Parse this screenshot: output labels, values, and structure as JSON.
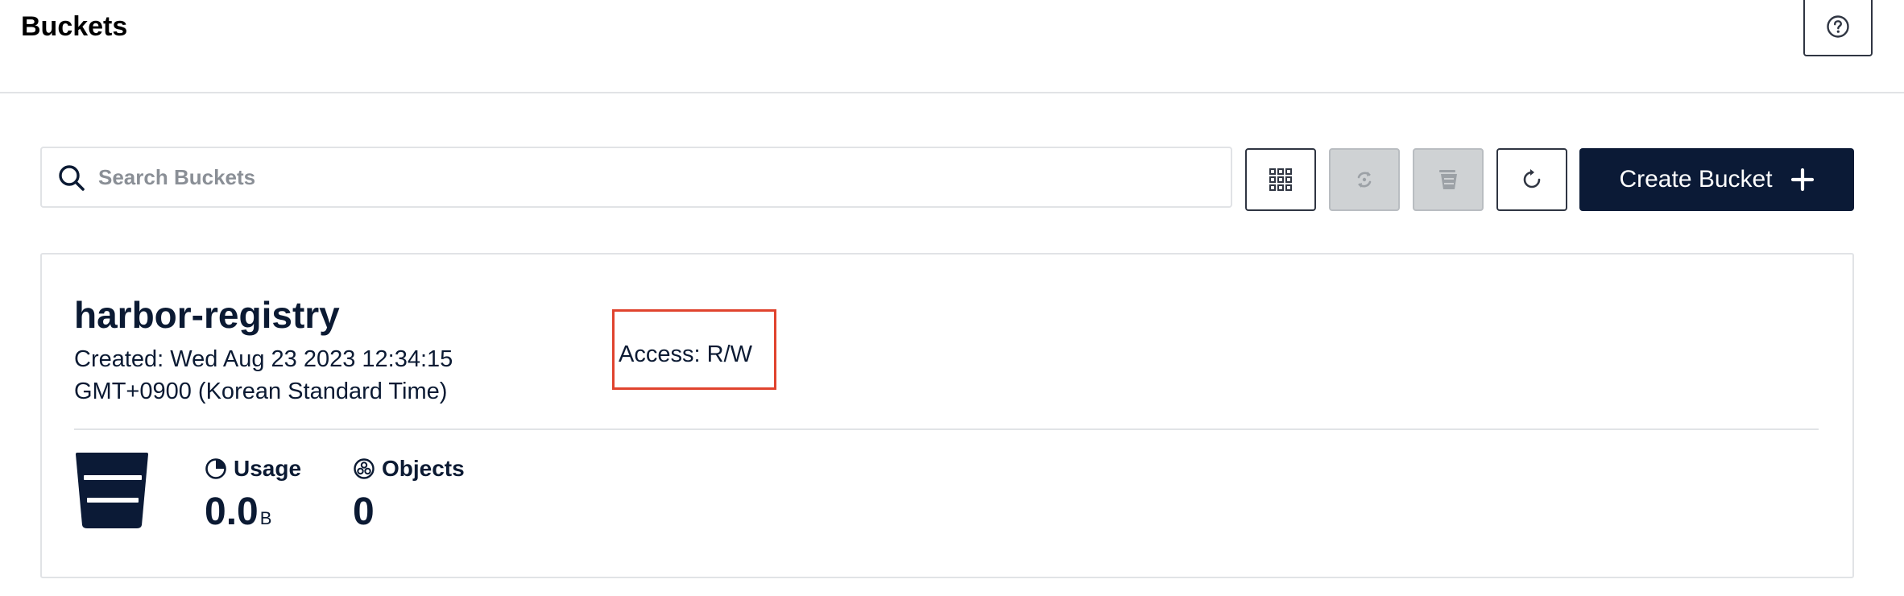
{
  "header": {
    "title": "Buckets",
    "help_icon": "help-circle-icon"
  },
  "toolbar": {
    "search": {
      "placeholder": "Search Buckets",
      "value": "",
      "icon": "search-icon"
    },
    "buttons": [
      {
        "icon": "grid-select-icon",
        "enabled": true
      },
      {
        "icon": "replication-icon",
        "enabled": false
      },
      {
        "icon": "bucket-lifecycle-icon",
        "enabled": false
      },
      {
        "icon": "refresh-icon",
        "enabled": true
      }
    ],
    "create_label": "Create Bucket",
    "create_icon": "plus-icon"
  },
  "bucket": {
    "name": "harbor-registry",
    "created": "Created: Wed Aug 23 2023 12:34:15 GMT+0900 (Korean Standard Time)",
    "access": "Access: R/W",
    "icon": "bucket-icon",
    "usage": {
      "label": "Usage",
      "value": "0.0",
      "unit": "B",
      "icon": "pie-chart-icon"
    },
    "objects": {
      "label": "Objects",
      "value": "0",
      "icon": "objects-icon"
    }
  },
  "colors": {
    "primary": "#0b1a36",
    "highlight": "#e0432e",
    "border": "#e1e3e6",
    "disabled_bg": "#cfd2d4"
  }
}
